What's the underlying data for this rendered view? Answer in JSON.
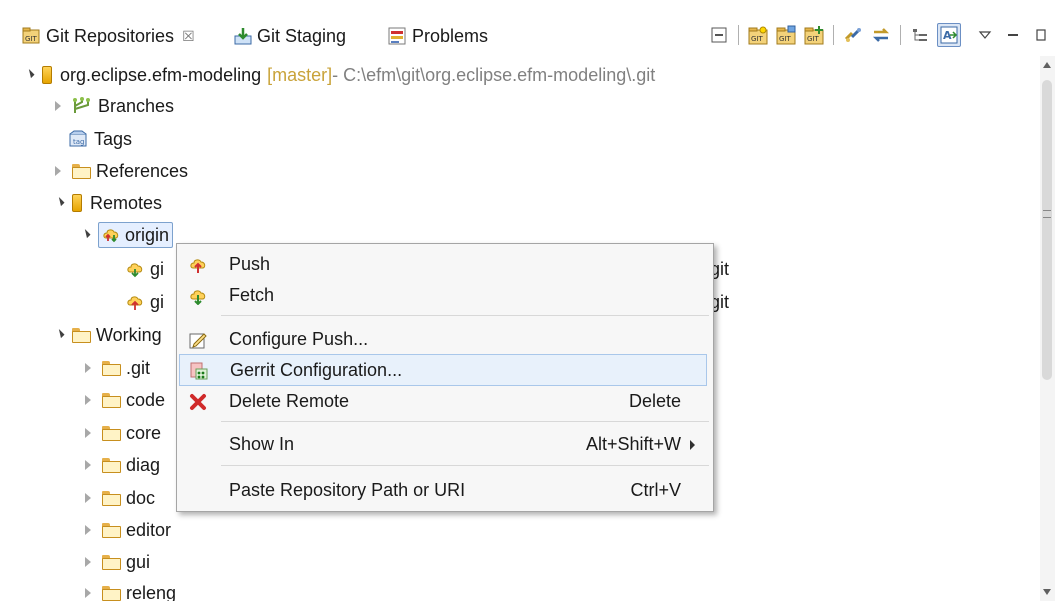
{
  "tabs": [
    {
      "label": "Git Repositories",
      "close": "☒"
    },
    {
      "label": "Git Staging"
    },
    {
      "label": "Problems"
    }
  ],
  "tree": {
    "repo": {
      "name": "org.eclipse.efm-modeling",
      "branch": "[master]",
      "path": " - C:\\efm\\git\\org.eclipse.efm-modeling\\.git"
    },
    "items": {
      "branches": "Branches",
      "tags": "Tags",
      "references": "References",
      "remotes": "Remotes",
      "origin": "origin",
      "remote_push_prefix": "gi",
      "remote_push_suffix": "git",
      "remote_fetch_prefix": "gi",
      "remote_fetch_suffix": "git",
      "working": "Working",
      "git": ".git",
      "code": "code",
      "core": "core",
      "diag": "diag",
      "doc": "doc",
      "editor": "editor",
      "gui": "gui",
      "releng": "releng"
    }
  },
  "context_menu": {
    "push": "Push",
    "fetch": "Fetch",
    "configure_push": "Configure Push...",
    "gerrit_configuration": "Gerrit Configuration...",
    "delete_remote": "Delete Remote",
    "delete_remote_key": "Delete",
    "show_in": "Show In",
    "show_in_key": "Alt+Shift+W",
    "paste_path": "Paste Repository Path or URI",
    "paste_path_key": "Ctrl+V"
  },
  "colors": {
    "accent": "#3a6fc4",
    "branch_label": "#c9a33a",
    "path_label": "#808080",
    "menu_hover": "#e8f1fb"
  }
}
